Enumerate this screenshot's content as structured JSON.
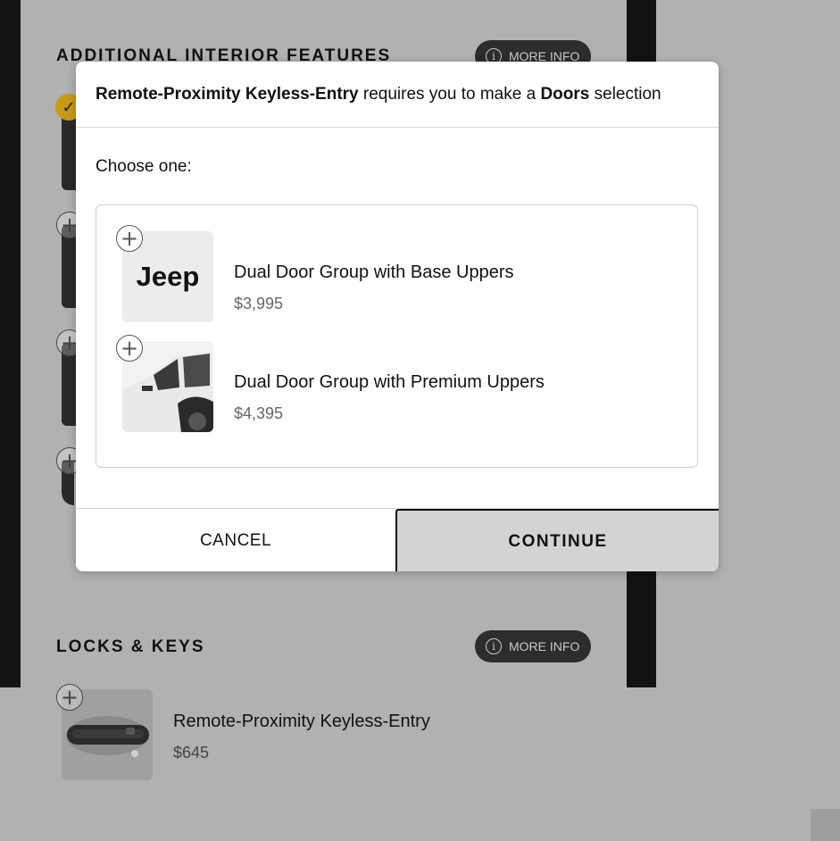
{
  "background": {
    "sections": [
      {
        "heading": "ADDITIONAL INTERIOR FEATURES",
        "more_info": "MORE INFO"
      },
      {
        "heading": "LOCKS & KEYS",
        "more_info": "MORE INFO"
      }
    ],
    "keyless_item": {
      "title": "Remote-Proximity Keyless-Entry",
      "price": "$645"
    },
    "colors": {
      "checked": "#c79a19",
      "dark_button": "#2d2d2d",
      "overlay": "#b1b1b1"
    }
  },
  "modal": {
    "header": {
      "feature": "Remote-Proximity Keyless-Entry",
      "middle": " requires you to make a ",
      "category": "Doors",
      "suffix": " selection"
    },
    "choose_label": "Choose one:",
    "options": [
      {
        "title": "Dual Door Group with Base Uppers",
        "price": "$3,995",
        "thumb_logo": "Jeep"
      },
      {
        "title": "Dual Door Group with Premium Uppers",
        "price": "$4,395"
      }
    ],
    "cancel_label": "CANCEL",
    "continue_label": "CONTINUE"
  }
}
